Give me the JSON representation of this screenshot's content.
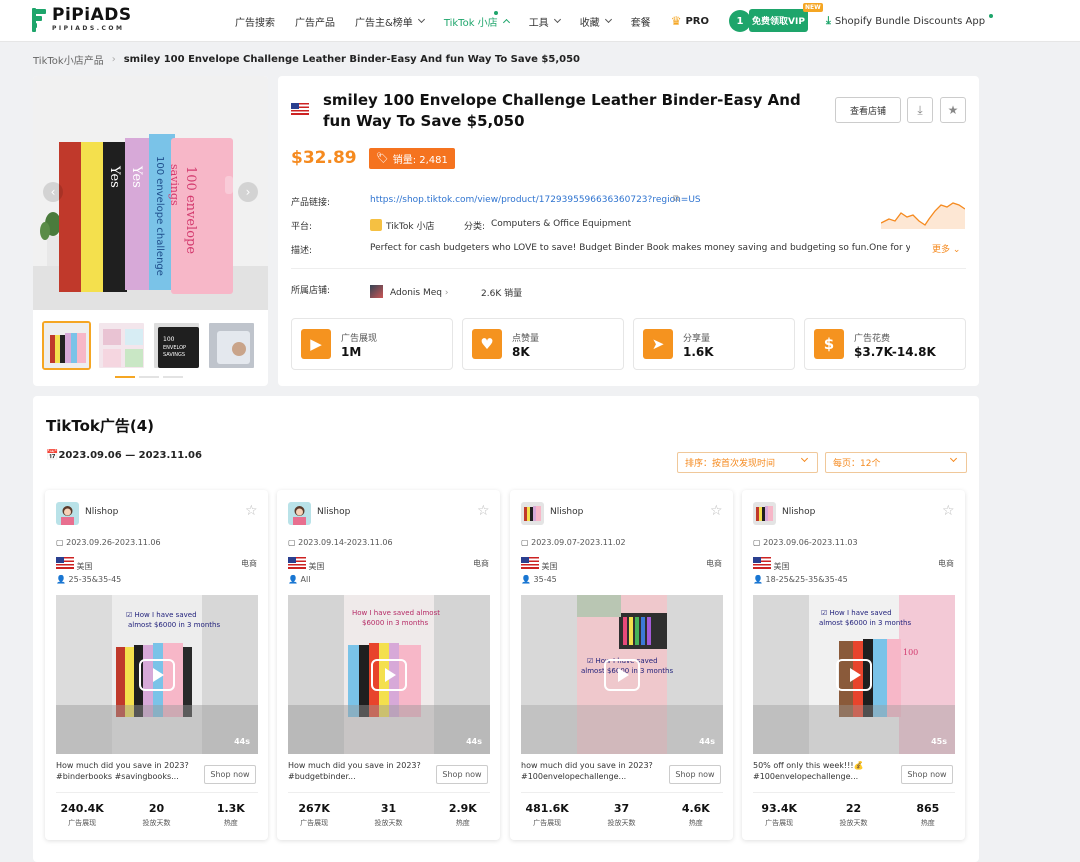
{
  "header": {
    "logo_text": "PiPiADS",
    "logo_sub": "PIPIADS.COM",
    "nav": [
      {
        "label": "广告搜索"
      },
      {
        "label": "广告产品"
      },
      {
        "label": "广告主&榜单"
      },
      {
        "label": "TikTok 小店"
      },
      {
        "label": "工具"
      },
      {
        "label": "收藏"
      },
      {
        "label": "套餐"
      }
    ],
    "pro_label": "PRO",
    "avatar_initial": "1",
    "vip_label": "免费领取VIP",
    "new_badge": "NEW",
    "shopify_label": "Shopify Bundle Discounts App"
  },
  "breadcrumb": {
    "parent": "TikTok小店产品",
    "current": "smiley 100 Envelope Challenge Leather Binder-Easy And fun Way To Save $5,050"
  },
  "product": {
    "title": "smiley 100 Envelope Challenge Leather Binder-Easy And fun Way To Save $5,050",
    "shop_button": "查看店铺",
    "price": "$32.89",
    "sales_label": "销量: 2,481",
    "link_label": "产品链接:",
    "link_value": "https://shop.tiktok.com/view/product/1729395596636360723?region=US",
    "platform_label": "平台:",
    "platform_value": "TikTok 小店",
    "category_label": "分类:",
    "category_value": "Computers & Office Equipment",
    "desc_label": "描述:",
    "desc_value": "Perfect for cash budgeters who LOVE to save! Budget Binder Book makes money saving and budgeting so fun.One for yourself and...",
    "more_label": "更多",
    "store_label": "所属店铺:",
    "store_name": "Adonis Meq",
    "store_sales": "2.6K 销量",
    "stats": [
      {
        "label": "广告展现",
        "value": "1M",
        "icon": "play-icon"
      },
      {
        "label": "点赞量",
        "value": "8K",
        "icon": "heart-icon"
      },
      {
        "label": "分享量",
        "value": "1.6K",
        "icon": "share-icon"
      },
      {
        "label": "广告花费",
        "value": "$3.7K-14.8K",
        "icon": "dollar-icon"
      }
    ]
  },
  "ads_section": {
    "title": "TikTok广告(4)",
    "date_range": "2023.09.06 — 2023.11.06",
    "sort_label": "排序：按首次发现时间",
    "per_page_label": "每页：12个",
    "cards": [
      {
        "name": "Nlishop",
        "dates": "2023.09.26-2023.11.06",
        "country": "美国",
        "category": "电商",
        "ages": "25-35&35-45",
        "duration": "44s",
        "caption": "How much did you save in 2023? #binderbooks #savingbooks...",
        "shop_now": "Shop now",
        "impressions": "240.4K",
        "days": "20",
        "heat": "1.3K"
      },
      {
        "name": "Nlishop",
        "dates": "2023.09.14-2023.11.06",
        "country": "美国",
        "category": "电商",
        "ages": "All",
        "duration": "44s",
        "caption": "How much did you save in 2023? #budgetbinder...",
        "shop_now": "Shop now",
        "impressions": "267K",
        "days": "31",
        "heat": "2.9K"
      },
      {
        "name": "Nlishop",
        "dates": "2023.09.07-2023.11.02",
        "country": "美国",
        "category": "电商",
        "ages": "35-45",
        "duration": "44s",
        "caption": "how much did you save in 2023? #100envelopechallenge...",
        "shop_now": "Shop now",
        "impressions": "481.6K",
        "days": "37",
        "heat": "4.6K"
      },
      {
        "name": "Nlishop",
        "dates": "2023.09.06-2023.11.03",
        "country": "美国",
        "category": "电商",
        "ages": "18-25&25-35&35-45",
        "duration": "45s",
        "caption": "50% off only this week!!!💰 #100envelopechallenge...",
        "shop_now": "Shop now",
        "impressions": "93.4K",
        "days": "22",
        "heat": "865"
      }
    ],
    "stat_labels": {
      "impressions": "广告展现",
      "days": "投放天数",
      "heat": "热度"
    }
  },
  "colors": {
    "brand": "#1ea56b",
    "accent": "#f58a1f"
  }
}
